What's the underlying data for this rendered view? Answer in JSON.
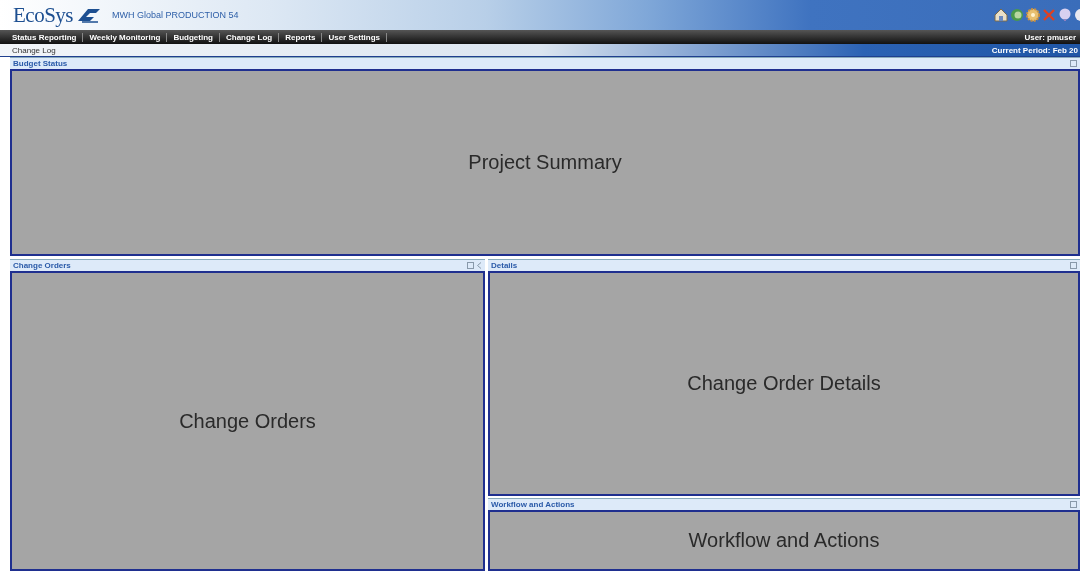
{
  "header": {
    "logo": "EcoSys",
    "environment": "MWH Global PRODUCTION 54"
  },
  "menu": [
    {
      "label": "Status Reporting"
    },
    {
      "label": "Weekly Monitoring"
    },
    {
      "label": "Budgeting"
    },
    {
      "label": "Change Log"
    },
    {
      "label": "Reports"
    },
    {
      "label": "User Settings"
    }
  ],
  "user": "User: pmuser",
  "breadcrumb": "Change Log",
  "current_period": "Current Period: Feb 20",
  "panels": {
    "budget_status": {
      "title": "Budget Status",
      "content": "Project Summary"
    },
    "change_orders": {
      "title": "Change Orders",
      "content": "Change Orders"
    },
    "details": {
      "title": "Details",
      "content": "Change Order Details"
    },
    "workflow": {
      "title": "Workflow and Actions",
      "content": "Workflow and Actions"
    }
  }
}
